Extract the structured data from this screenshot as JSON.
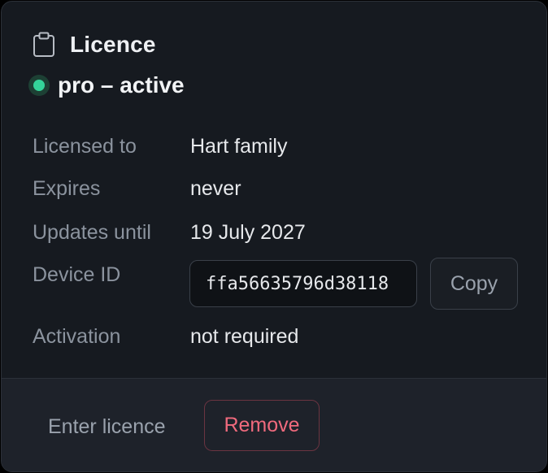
{
  "header": {
    "title": "Licence",
    "icon": "clipboard-icon"
  },
  "status": {
    "text": "pro – active",
    "dot_color": "#34d399"
  },
  "details": {
    "licensed_to_label": "Licensed to",
    "licensed_to_value": "Hart family",
    "expires_label": "Expires",
    "expires_value": "never",
    "updates_label": "Updates until",
    "updates_value": "19 July 2027",
    "device_id_label": "Device ID",
    "device_id_value": "ffa56635796d38118",
    "copy_label": "Copy",
    "activation_label": "Activation",
    "activation_value": "not required"
  },
  "footer": {
    "enter_label": "Enter licence",
    "remove_label": "Remove"
  },
  "colors": {
    "background": "#161a20",
    "danger": "#f06a7d",
    "success": "#34d399"
  }
}
